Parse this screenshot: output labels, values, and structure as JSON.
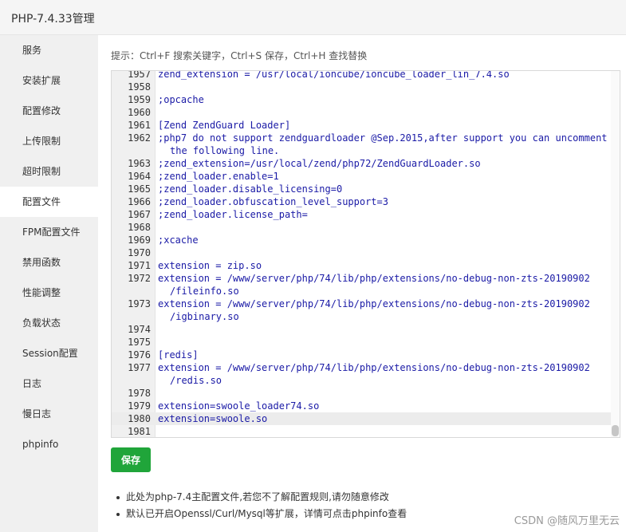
{
  "window": {
    "title": "PHP-7.4.33管理"
  },
  "sidebar": {
    "items": [
      {
        "label": "服务"
      },
      {
        "label": "安装扩展"
      },
      {
        "label": "配置修改"
      },
      {
        "label": "上传限制"
      },
      {
        "label": "超时限制"
      },
      {
        "label": "配置文件",
        "active": true
      },
      {
        "label": "FPM配置文件"
      },
      {
        "label": "禁用函数"
      },
      {
        "label": "性能调整"
      },
      {
        "label": "负载状态"
      },
      {
        "label": "Session配置"
      },
      {
        "label": "日志"
      },
      {
        "label": "慢日志"
      },
      {
        "label": "phpinfo"
      }
    ]
  },
  "main": {
    "tip": "提示：Ctrl+F 搜索关键字，Ctrl+S 保存，Ctrl+H 查找替换",
    "save_label": "保存",
    "notes": [
      "此处为php-7.4主配置文件,若您不了解配置规则,请勿随意修改",
      "默认已开启Openssl/Curl/Mysql等扩展，详情可点击phpinfo查看"
    ]
  },
  "editor": {
    "lines": [
      {
        "num": "1957",
        "text": "zend_extension = /usr/local/ioncube/ioncube_loader_lin_7.4.so"
      },
      {
        "num": "1958",
        "text": ""
      },
      {
        "num": "1959",
        "text": ";opcache"
      },
      {
        "num": "1960",
        "text": ""
      },
      {
        "num": "1961",
        "text": "[Zend ZendGuard Loader]"
      },
      {
        "num": "1962",
        "text": ";php7 do not support zendguardloader @Sep.2015,after support you can uncomment",
        "cont": "the following line."
      },
      {
        "num": "1963",
        "text": ";zend_extension=/usr/local/zend/php72/ZendGuardLoader.so"
      },
      {
        "num": "1964",
        "text": ";zend_loader.enable=1"
      },
      {
        "num": "1965",
        "text": ";zend_loader.disable_licensing=0"
      },
      {
        "num": "1966",
        "text": ";zend_loader.obfuscation_level_support=3"
      },
      {
        "num": "1967",
        "text": ";zend_loader.license_path="
      },
      {
        "num": "1968",
        "text": ""
      },
      {
        "num": "1969",
        "text": ";xcache"
      },
      {
        "num": "1970",
        "text": ""
      },
      {
        "num": "1971",
        "text": "extension = zip.so"
      },
      {
        "num": "1972",
        "text": "extension = /www/server/php/74/lib/php/extensions/no-debug-non-zts-20190902",
        "cont": "/fileinfo.so"
      },
      {
        "num": "1973",
        "text": "extension = /www/server/php/74/lib/php/extensions/no-debug-non-zts-20190902",
        "cont": "/igbinary.so"
      },
      {
        "num": "1974",
        "text": ""
      },
      {
        "num": "1975",
        "text": ""
      },
      {
        "num": "1976",
        "text": "[redis]"
      },
      {
        "num": "1977",
        "text": "extension = /www/server/php/74/lib/php/extensions/no-debug-non-zts-20190902",
        "cont": "/redis.so"
      },
      {
        "num": "1978",
        "text": ""
      },
      {
        "num": "1979",
        "text": "extension=swoole_loader74.so"
      },
      {
        "num": "1980",
        "text": "extension=swoole.so",
        "active": true
      },
      {
        "num": "1981",
        "text": ""
      }
    ]
  },
  "watermark": "CSDN @随风万里无云",
  "colors": {
    "accent": "#20a53a",
    "code_text": "#1a1aa6",
    "sidebar_bg": "#f0f0f0"
  }
}
